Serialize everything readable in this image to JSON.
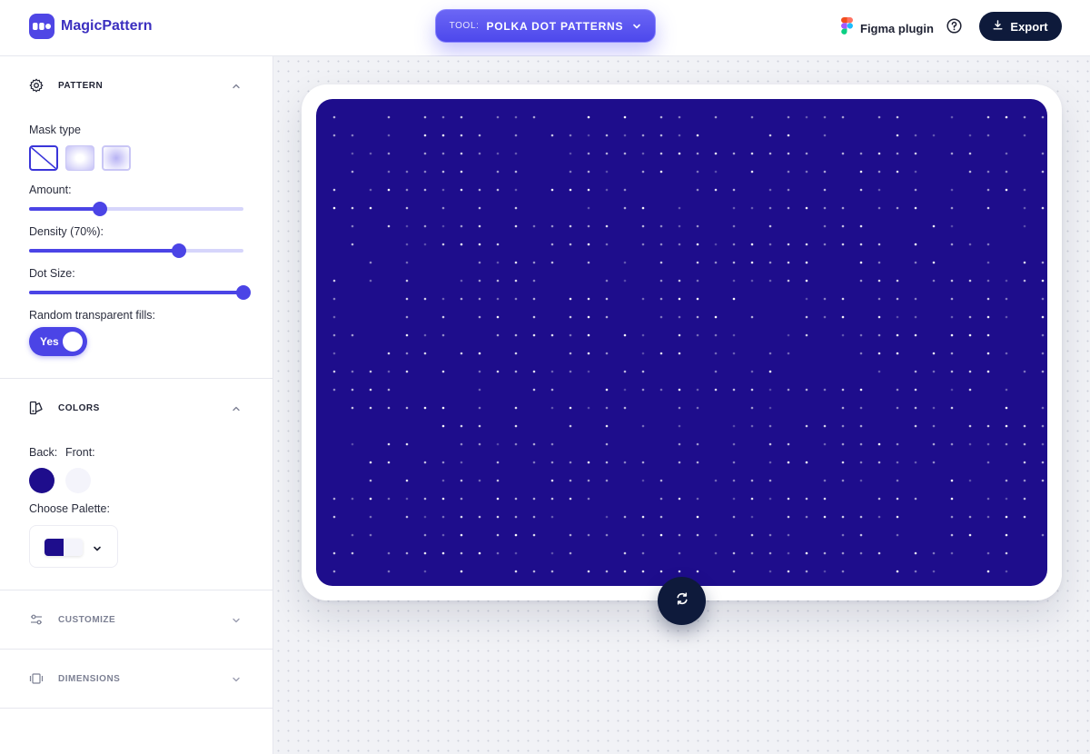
{
  "header": {
    "brand": "MagicPattern",
    "tool_prefix": "TOOL:",
    "tool_name": "POLKA DOT PATTERNS",
    "figma_label": "Figma plugin",
    "export_label": "Export"
  },
  "sidebar": {
    "pattern": {
      "title": "PATTERN",
      "mask_type_label": "Mask type",
      "amount_label": "Amount:",
      "amount_value": 0.33,
      "density_label": "Density (70%):",
      "density_value": 0.7,
      "dot_size_label": "Dot Size:",
      "dot_size_value": 1.0,
      "random_fills_label": "Random transparent fills:",
      "random_fills_toggle": "Yes"
    },
    "colors": {
      "title": "COLORS",
      "back_label": "Back:",
      "front_label": "Front:",
      "back_color": "#1e0d8c",
      "front_color": "#f4f4fb",
      "palette_label": "Choose Palette:"
    },
    "customize": {
      "title": "CUSTOMIZE"
    },
    "dimensions": {
      "title": "DIMENSIONS"
    }
  },
  "colors": {
    "accent": "#4b44e6",
    "dark": "#0e1a3b",
    "pattern_background": "#1e0d8c",
    "pattern_dot": "#ffffff"
  }
}
